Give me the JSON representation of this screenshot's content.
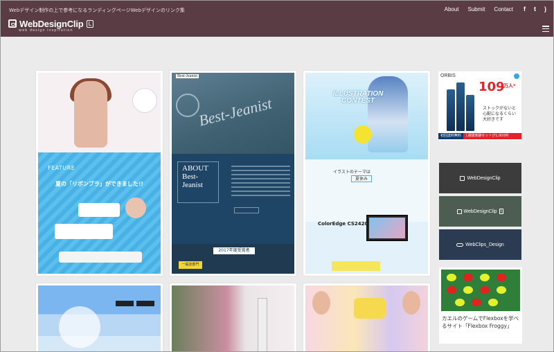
{
  "header": {
    "tagline": "Webデザイン制作の上で参考になるランディングページWebデザインのリンク集",
    "logo_text": "WebDesignClip",
    "logo_badge": "L",
    "logo_sub": "web design inspiration",
    "nav": [
      "About",
      "Submit",
      "Contact"
    ],
    "social_icons": [
      "facebook-icon",
      "twitter-icon",
      "rss-icon"
    ],
    "social_glyphs": [
      "f",
      "t",
      ")"
    ]
  },
  "cards": {
    "card1": {
      "feature": "FEATURE",
      "headline": "夏の「リボンブラ」ができました!!"
    },
    "card2": {
      "brand": "Best-Jeanist",
      "emblem_text": "Best-Jeanist",
      "about": "ABOUT Best-Jeanist",
      "award": "2017年度受賞者",
      "dept": "一般誌部門"
    },
    "card3": {
      "title": "ILLUSTRATION CONTEST",
      "theme_label": "イラストのテーマは",
      "theme_value": "夏休み",
      "product": "ColorEdge CS2420"
    }
  },
  "ad": {
    "brand": "ORBIS",
    "count": "109",
    "count_unit": "万人*",
    "copy": "ストックがないと心配になるくらい大好きです",
    "left_bar": "初回送料無料",
    "right_bar": "1週間体験セットが1,000円"
  },
  "sidebar_buttons": [
    {
      "label": "WebDesignClip",
      "badge": "",
      "bg": "#3c3c3c",
      "icon": "clip-logo-icon"
    },
    {
      "label": "WebDesignClip",
      "badge": "L",
      "bg": "#4d5d52",
      "icon": "clip-logo-icon"
    },
    {
      "label": "WebClips_Design",
      "badge": "",
      "bg": "#2b3b52",
      "icon": "clips-pill-icon"
    }
  ],
  "froggy": {
    "caption": "カエルのゲームでFlexboxを学べるサイト「Flexbox Froggy」"
  },
  "colors": {
    "header_bg": "#5a3c44",
    "page_bg": "#ebebeb"
  }
}
